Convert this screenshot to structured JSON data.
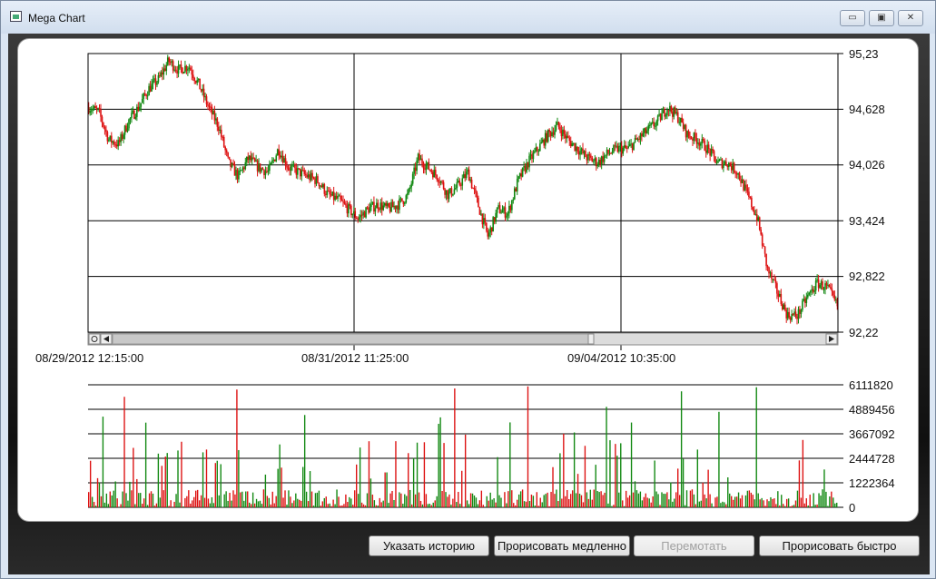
{
  "window": {
    "title": "Mega Chart",
    "minimize_glyph": "▭",
    "maximize_glyph": "▣",
    "close_glyph": "✕"
  },
  "buttons": {
    "history": "Указать историю",
    "slow": "Прорисовать медленно",
    "rewind": "Перемотать",
    "fast": "Прорисовать быстро"
  },
  "colors": {
    "up": "#118811",
    "down": "#dd1111"
  },
  "chart_data": [
    {
      "type": "candlestick",
      "y_ticks": [
        "95,23",
        "94,628",
        "94,026",
        "93,424",
        "92,822",
        "92,22"
      ],
      "ylim": [
        92.22,
        95.23
      ],
      "x_ticks": [
        "08/29/2012 12:15:00",
        "08/31/2012 11:25:00",
        "09/04/2012 10:35:00"
      ],
      "grid": true,
      "close_profile": [
        94.65,
        94.6,
        94.3,
        94.25,
        94.5,
        94.65,
        94.85,
        94.95,
        95.15,
        95.05,
        95.1,
        94.9,
        94.65,
        94.45,
        94.05,
        93.9,
        94.1,
        94.0,
        93.95,
        94.2,
        94.0,
        93.95,
        93.9,
        93.85,
        93.7,
        93.65,
        93.55,
        93.45,
        93.55,
        93.6,
        93.55,
        93.6,
        93.7,
        94.1,
        94.0,
        93.9,
        93.7,
        93.8,
        93.95,
        93.6,
        93.25,
        93.55,
        93.5,
        93.85,
        94.05,
        94.2,
        94.35,
        94.45,
        94.3,
        94.2,
        94.1,
        94.05,
        94.15,
        94.2,
        94.2,
        94.3,
        94.4,
        94.5,
        94.65,
        94.55,
        94.35,
        94.3,
        94.2,
        94.05,
        94.05,
        93.95,
        93.7,
        93.45,
        92.9,
        92.65,
        92.4,
        92.4,
        92.6,
        92.75,
        92.7,
        92.5
      ],
      "volume_y_ticks": [
        "6111820",
        "4889456",
        "3667092",
        "2444728",
        "1222364",
        "0"
      ],
      "volume_ylim": [
        0,
        6111820
      ]
    }
  ]
}
